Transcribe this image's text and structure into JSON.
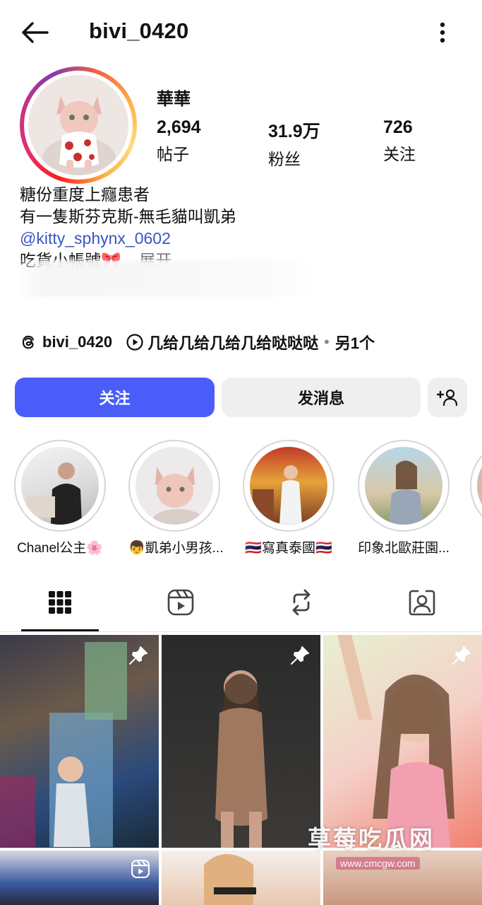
{
  "header": {
    "username": "bivi_0420",
    "back_icon": "arrow-left-icon",
    "more_icon": "vertical-ellipsis-icon"
  },
  "profile": {
    "display_name": "華華",
    "stats": [
      {
        "value": "2,694",
        "label": "帖子"
      },
      {
        "value": "31.9万",
        "label": "粉丝"
      },
      {
        "value": "726",
        "label": "关注"
      }
    ],
    "bio": {
      "line1": "糖份重度上癮患者",
      "line2": "有一隻斯芬克斯-無毛貓叫凱弟",
      "mention": "@kitty_sphynx_0602",
      "line4": "吃貨小帳號🎀",
      "ellipsis": "... ",
      "expand": "展开"
    },
    "links": {
      "threads_handle": "bivi_0420",
      "music_track": "几给几给几给几给哒哒哒",
      "more": "另1个"
    }
  },
  "actions": {
    "follow": "关注",
    "message": "发消息",
    "add_user_icon": "add-user-icon"
  },
  "highlights": [
    {
      "label": "Chanel公主🌸"
    },
    {
      "label": "👦凱弟小男孩..."
    },
    {
      "label": "🇹🇭寫真泰國🇹🇭"
    },
    {
      "label": "印象北歐莊園..."
    }
  ],
  "tabs": [
    "grid-icon",
    "reels-icon",
    "reposts-icon",
    "tagged-icon"
  ],
  "watermark": {
    "text": "草莓吃瓜网",
    "url": "www.cmcgw.com"
  },
  "colors": {
    "accent": "#4a5df9",
    "secondary_button": "#efefef",
    "mention": "#3a55c4"
  }
}
